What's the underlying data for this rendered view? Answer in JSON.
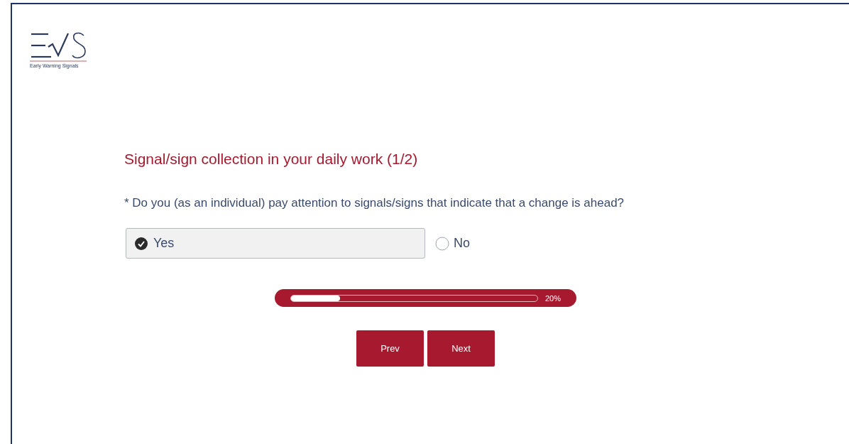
{
  "logo": {
    "tagline": "Early Warning Signals"
  },
  "section_title": "Signal/sign collection in your daily work (1/2)",
  "question": {
    "text": "* Do you (as an individual) pay attention to signals/signs that indicate that a change is ahead?",
    "options": [
      {
        "label": "Yes",
        "selected": true
      },
      {
        "label": "No",
        "selected": false
      }
    ]
  },
  "progress": {
    "level": 0.2,
    "reading": "20%"
  },
  "buttons": [
    "Prev",
    "Next"
  ]
}
